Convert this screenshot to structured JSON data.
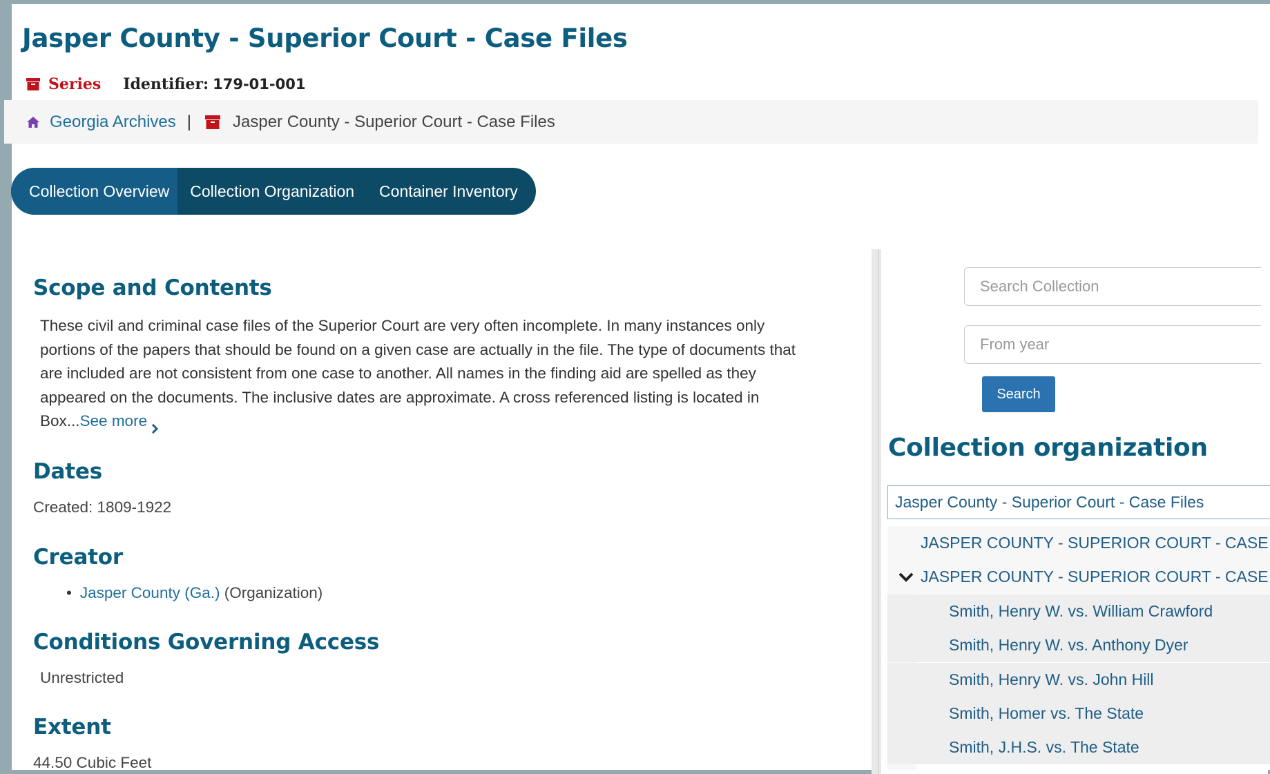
{
  "header": {
    "title": "Jasper County - Superior Court - Case Files",
    "type_label": "Series",
    "identifier_label": "Identifier:",
    "identifier_value": "179-01-001"
  },
  "breadcrumb": {
    "home_label": "Georgia Archives",
    "separator": "|",
    "current_label": "Jasper County - Superior Court - Case Files"
  },
  "tabs": [
    {
      "label": "Collection Overview",
      "active": true
    },
    {
      "label": "Collection Organization",
      "active": false
    },
    {
      "label": "Container Inventory",
      "active": false
    }
  ],
  "sections": {
    "scope": {
      "heading": "Scope and Contents",
      "lines": [
        "These civil and criminal case files of the Superior Court are very often incomplete. In many instances only",
        "portions of the papers that should be found on a given case are actually in the file. The type of documents that",
        "are included are not consistent from one case to another. All names in the finding aid are spelled as they",
        "appeared on the documents. The inclusive dates are approximate. A cross referenced listing is located in"
      ],
      "last_line": "Box...",
      "see_more": "See more"
    },
    "dates": {
      "heading": "Dates",
      "value": "Created: 1809-1922"
    },
    "creator": {
      "heading": "Creator",
      "link": "Jasper County (Ga.)",
      "role": "(Organization)"
    },
    "access": {
      "heading": "Conditions Governing Access",
      "value": "Unrestricted"
    },
    "extent": {
      "heading": "Extent",
      "value": "44.50 Cubic Feet"
    }
  },
  "sidebar": {
    "search_placeholder": "Search Collection",
    "from_year_placeholder": "From year",
    "search_button": "Search",
    "org_heading": "Collection organization",
    "tree": {
      "root": "Jasper County - Superior Court - Case Files",
      "children": [
        "JASPER COUNTY - SUPERIOR COURT - CASE FILES",
        "JASPER COUNTY - SUPERIOR COURT - CASE FILES"
      ],
      "grandchildren": [
        "Smith, Henry W. vs. William Crawford",
        "Smith, Henry W. vs. Anthony Dyer",
        "Smith, Henry W. vs. John Hill",
        "Smith, Homer vs. The State",
        "Smith, J.H.S. vs. The State"
      ]
    }
  },
  "colors": {
    "heading": "#0d5e7e",
    "link": "#1f6f99",
    "series_red": "#c1131c",
    "tab_bar": "#0d4a66",
    "tab_active": "#155d86",
    "button": "#2b72b0"
  }
}
